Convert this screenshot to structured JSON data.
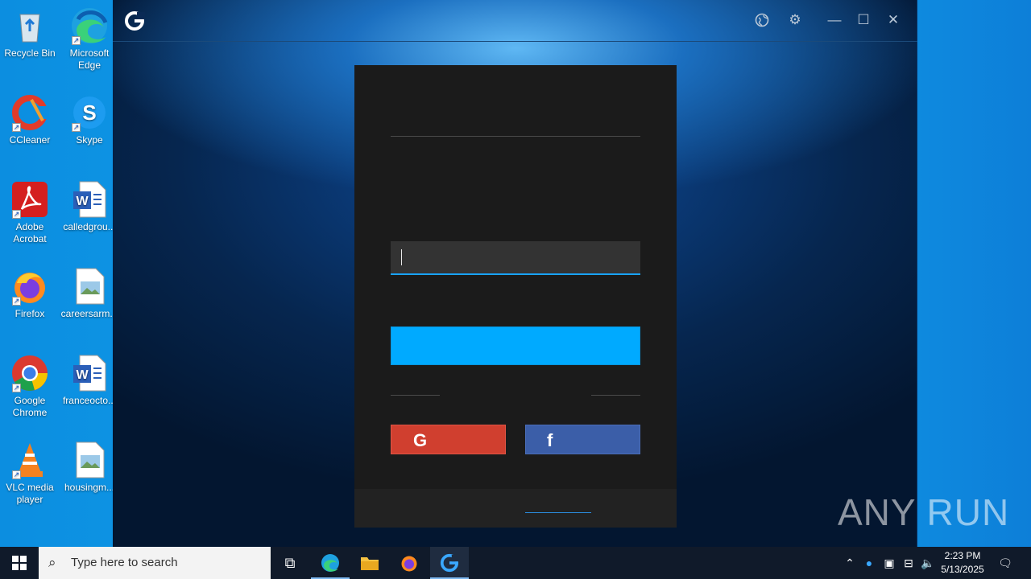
{
  "desktop": {
    "icons": [
      {
        "label": "Recycle Bin",
        "icon": "recycle-bin-icon"
      },
      {
        "label": "Microsoft Edge",
        "icon": "edge-icon"
      },
      {
        "label": "CCleaner",
        "icon": "ccleaner-icon"
      },
      {
        "label": "Skype",
        "icon": "skype-icon"
      },
      {
        "label": "Adobe Acrobat",
        "icon": "acrobat-icon"
      },
      {
        "label": "calledgrou...",
        "icon": "word-doc-icon"
      },
      {
        "label": "Firefox",
        "icon": "firefox-icon"
      },
      {
        "label": "careersarm...",
        "icon": "image-file-icon"
      },
      {
        "label": "Google Chrome",
        "icon": "chrome-icon"
      },
      {
        "label": "franceocto...",
        "icon": "word-doc-icon"
      },
      {
        "label": "VLC media player",
        "icon": "vlc-icon"
      },
      {
        "label": "housingm...",
        "icon": "image-file-icon"
      }
    ]
  },
  "app": {
    "logo_letter": "G",
    "titlebar_icons": [
      "globe-icon",
      "gear-icon",
      "minimize-icon",
      "maximize-icon",
      "close-icon"
    ],
    "login": {
      "input_value": "",
      "google_letter": "G",
      "facebook_letter": "f"
    }
  },
  "watermark": {
    "text": "ANY RUN"
  },
  "taskbar": {
    "search_placeholder": "Type here to search",
    "time": "2:23 PM",
    "date": "5/13/2025"
  },
  "colors": {
    "accent": "#00aaff",
    "google": "#d03f2f",
    "facebook": "#3b5ea8"
  }
}
